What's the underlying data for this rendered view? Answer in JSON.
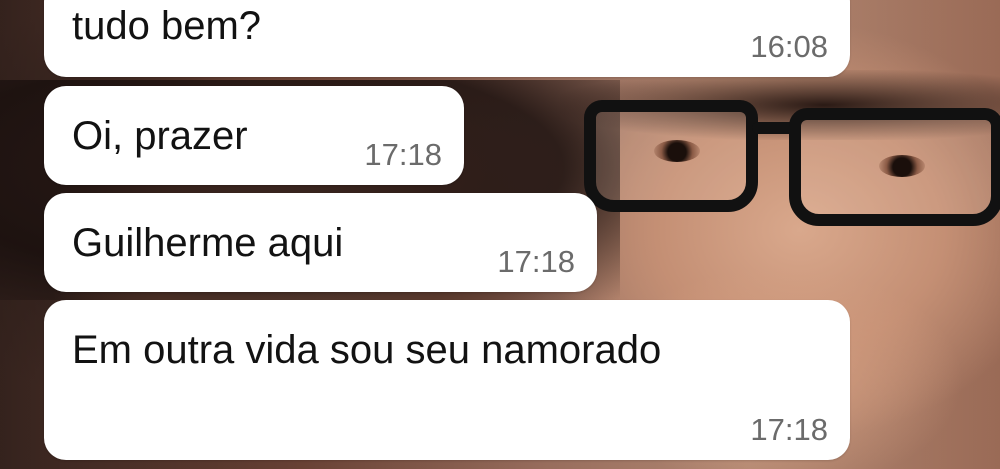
{
  "wallpaper": {
    "description_icon": "photo-wallpaper"
  },
  "messages": [
    {
      "text": "tudo bem?",
      "time": "16:08"
    },
    {
      "text": "Oi, prazer",
      "time": "17:18"
    },
    {
      "text": "Guilherme aqui",
      "time": "17:18"
    },
    {
      "text": "Em outra vida sou seu namorado",
      "time": "17:18"
    }
  ],
  "colors": {
    "bubble": "#ffffff",
    "text": "#121212",
    "time": "#6b6b6b"
  }
}
